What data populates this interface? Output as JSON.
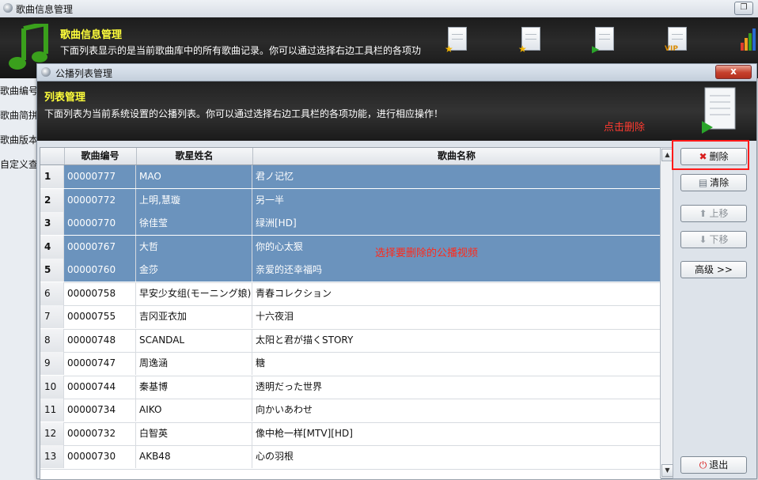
{
  "outer_window": {
    "title": "歌曲信息管理",
    "banner_title": "歌曲信息管理",
    "banner_desc": "下面列表显示的是当前歌曲库中的所有歌曲记录。你可以通过选择右边工具栏的各项功",
    "left_items": [
      "歌曲编号",
      "歌曲简拼",
      "歌曲版本",
      "自定义查"
    ],
    "toolbar_icons": [
      "doc-star-icon",
      "doc-star-icon",
      "doc-play-icon",
      "doc-vip-icon"
    ]
  },
  "dialog": {
    "title": "公播列表管理",
    "close_label": "x",
    "banner_title": "列表管理",
    "banner_desc": "下面列表为当前系统设置的公播列表。你可以通过选择右边工具栏的各项功能，进行相应操作！",
    "annotation_delete": "点击删除",
    "annotation_select": "选择要删除的公播视频"
  },
  "table": {
    "columns": [
      "",
      "歌曲编号",
      "歌星姓名",
      "歌曲名称"
    ],
    "rows": [
      {
        "idx": "1",
        "code": "00000777",
        "artist": "MAO",
        "song": "君ノ记忆",
        "selected": true
      },
      {
        "idx": "2",
        "code": "00000772",
        "artist": "上明,慧璇",
        "song": "另一半",
        "selected": true
      },
      {
        "idx": "3",
        "code": "00000770",
        "artist": "徐佳莹",
        "song": "绿洲[HD]",
        "selected": true
      },
      {
        "idx": "4",
        "code": "00000767",
        "artist": "大哲",
        "song": "你的心太狠",
        "selected": true
      },
      {
        "idx": "5",
        "code": "00000760",
        "artist": "金莎",
        "song": "亲爱的还幸福吗",
        "selected": true
      },
      {
        "idx": "6",
        "code": "00000758",
        "artist": "早安少女组(モーニング娘)",
        "song": "青春コレクション",
        "selected": false
      },
      {
        "idx": "7",
        "code": "00000755",
        "artist": "吉冈亚衣加",
        "song": "十六夜泪",
        "selected": false
      },
      {
        "idx": "8",
        "code": "00000748",
        "artist": "SCANDAL",
        "song": "太阳と君が描くSTORY",
        "selected": false
      },
      {
        "idx": "9",
        "code": "00000747",
        "artist": "周逸涵",
        "song": "糖",
        "selected": false
      },
      {
        "idx": "10",
        "code": "00000744",
        "artist": "秦基博",
        "song": "透明だった世界",
        "selected": false
      },
      {
        "idx": "11",
        "code": "00000734",
        "artist": "AIKO",
        "song": "向かいあわせ",
        "selected": false
      },
      {
        "idx": "12",
        "code": "00000732",
        "artist": "白智英",
        "song": "像中枪一样[MTV][HD]",
        "selected": false
      },
      {
        "idx": "13",
        "code": "00000730",
        "artist": "AKB48",
        "song": "心の羽根",
        "selected": false
      }
    ]
  },
  "buttons": {
    "delete": "删除",
    "clear": "清除",
    "move_up": "上移",
    "move_down": "下移",
    "advanced": "高级 >>",
    "exit": "退出"
  },
  "colors": {
    "selection": "#6b93bd",
    "annotation": "#ff2a1a",
    "banner_title": "#ffff3b"
  }
}
